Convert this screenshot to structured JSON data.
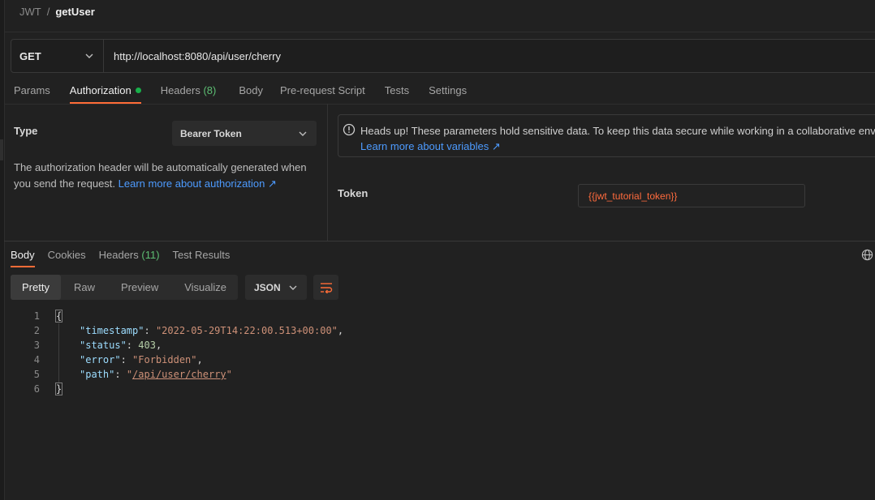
{
  "breadcrumb": {
    "collection": "JWT",
    "separator": "/",
    "request": "getUser"
  },
  "request": {
    "method": "GET",
    "url": "http://localhost:8080/api/user/cherry",
    "tabs": [
      {
        "label": "Params"
      },
      {
        "label": "Authorization",
        "active": true,
        "indicator": true
      },
      {
        "label": "Headers",
        "count": "(8)"
      },
      {
        "label": "Body"
      },
      {
        "label": "Pre-request Script"
      },
      {
        "label": "Tests"
      },
      {
        "label": "Settings"
      }
    ]
  },
  "auth": {
    "type_label": "Type",
    "type_value": "Bearer Token",
    "description": "The authorization header will be automatically generated when you send the request. ",
    "description_link": "Learn more about authorization ↗",
    "alert_text": "Heads up! These parameters hold sensitive data. To keep this data secure while working in a collaborative environment",
    "alert_link": "Learn more about variables ↗",
    "token_label": "Token",
    "token_value": "{{jwt_tutorial_token}}"
  },
  "response": {
    "tabs": [
      {
        "label": "Body",
        "active": true
      },
      {
        "label": "Cookies"
      },
      {
        "label": "Headers",
        "count": "(11)"
      },
      {
        "label": "Test Results"
      }
    ],
    "formats": [
      "Pretty",
      "Raw",
      "Preview",
      "Visualize"
    ],
    "active_format": "Pretty",
    "language": "JSON",
    "body_lines": [
      {
        "num": "1",
        "open": "{"
      },
      {
        "num": "2",
        "key": "\"timestamp\"",
        "value": "\"2022-05-29T14:22:00.513+00:00\"",
        "kind": "str",
        "trail": ","
      },
      {
        "num": "3",
        "key": "\"status\"",
        "value": "403",
        "kind": "num",
        "trail": ","
      },
      {
        "num": "4",
        "key": "\"error\"",
        "value": "\"Forbidden\"",
        "kind": "str",
        "trail": ","
      },
      {
        "num": "5",
        "key": "\"path\"",
        "value_q1": "\"",
        "value_link": "/api/user/cherry",
        "value_q2": "\"",
        "kind": "link",
        "trail": ""
      },
      {
        "num": "6",
        "close": "}"
      }
    ]
  },
  "colors": {
    "accent": "#ff6c37",
    "link": "#4d9bff",
    "count": "#5dbe73",
    "token": "#ff6b3d",
    "dot": "#18b04a"
  },
  "icons": [
    "chevron-down-icon",
    "info-icon",
    "globe-icon",
    "wrap-lines-icon"
  ]
}
